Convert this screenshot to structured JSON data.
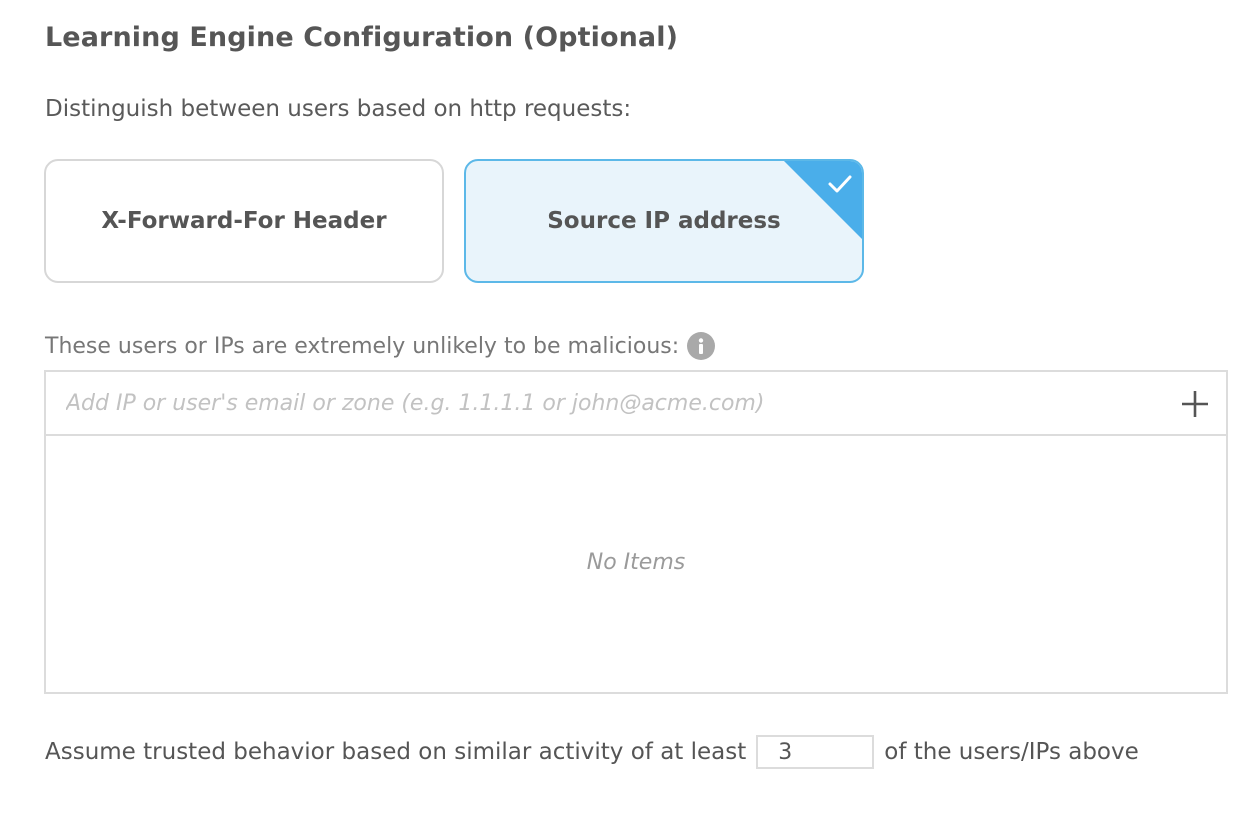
{
  "section": {
    "title": "Learning Engine Configuration (Optional)",
    "subtitle": "Distinguish between users based on http requests:"
  },
  "options": [
    {
      "label": "X-Forward-For Header",
      "selected": false
    },
    {
      "label": "Source IP address",
      "selected": true
    }
  ],
  "trusted": {
    "label": "These users or IPs are extremely unlikely to be malicious:",
    "input_value": "",
    "placeholder": "Add IP or user's email or zone (e.g. 1.1.1.1 or john@acme.com)",
    "empty_text": "No Items"
  },
  "threshold": {
    "prefix": "Assume trusted behavior based on similar activity of at least",
    "value": "3",
    "suffix": "of the users/IPs above"
  },
  "colors": {
    "selected_border": "#5cb8e8",
    "selected_bg": "#e9f4fb",
    "check_corner": "#4aaeea"
  },
  "icons": {
    "info": "info-icon",
    "add": "plus-icon",
    "check": "checkmark-icon"
  }
}
